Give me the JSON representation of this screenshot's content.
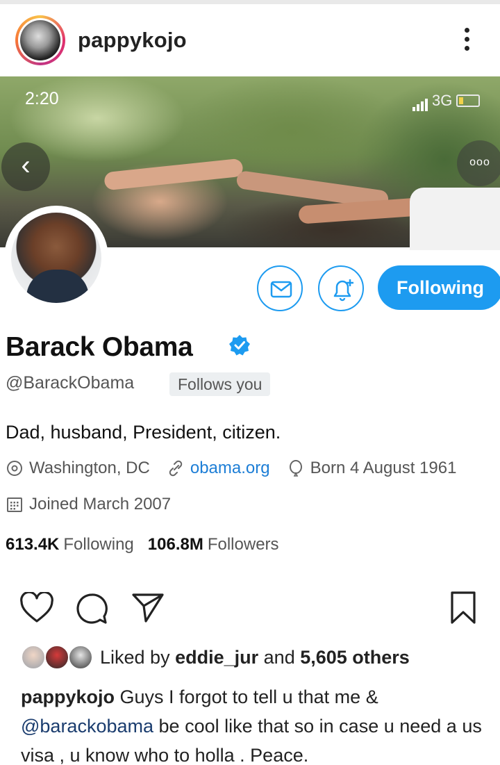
{
  "header": {
    "username": "pappykojo",
    "menu_icon": "vertical-dots-icon"
  },
  "post": {
    "status_bar": {
      "time": "2:20",
      "network": "3G"
    },
    "profile": {
      "name": "Barack Obama",
      "handle": "@BarackObama",
      "follows_you": "Follows you",
      "bio": "Dad, husband, President, citizen.",
      "location": "Washington, DC",
      "website": "obama.org",
      "birthday": "Born 4 August 1961",
      "joined": "Joined March 2007",
      "following_count": "613.4K",
      "following_label": "Following",
      "followers_count": "106.8M",
      "followers_label": "Followers",
      "follow_button": "Following",
      "accent_color": "#1d9bf0"
    }
  },
  "actions": {
    "like_icon": "heart-icon",
    "comment_icon": "comment-icon",
    "share_icon": "send-icon",
    "save_icon": "bookmark-icon"
  },
  "likes": {
    "prefix": "Liked by",
    "user": "eddie_jur",
    "middle": "and",
    "others": "5,605 others"
  },
  "caption": {
    "username": "pappykojo",
    "text_before": "Guys I forgot to tell u that me &",
    "mention": "@barackobama",
    "text_after": "be cool like that so in case u need a us visa , u know who to holla . Peace."
  }
}
